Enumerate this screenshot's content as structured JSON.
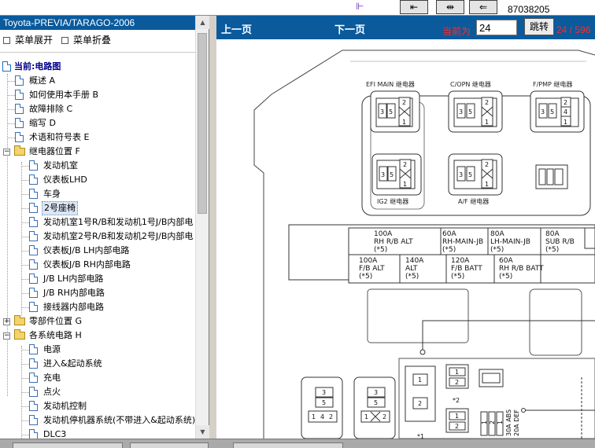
{
  "topbar": {
    "book_id": "87038205",
    "corner_mark": "⊩"
  },
  "tree": {
    "title": "Toyota-PREVIA/TARAGO-2006",
    "expand_label": "菜单展开",
    "collapse_label": "菜单折叠",
    "root_label": "当前:电路图",
    "items": [
      {
        "label": "概述 A"
      },
      {
        "label": "如何使用本手册 B"
      },
      {
        "label": "故障排除 C"
      },
      {
        "label": "缩写 D"
      },
      {
        "label": "术语和符号表 E"
      },
      {
        "label": "继电器位置 F"
      },
      {
        "label": "发动机室"
      },
      {
        "label": "仪表板LHD"
      },
      {
        "label": "车身"
      },
      {
        "label": "2号座椅"
      },
      {
        "label": "发动机室1号R/B和发动机1号J/B内部电"
      },
      {
        "label": "发动机室2号R/B和发动机2号J/B内部电"
      },
      {
        "label": "仪表板J/B LH内部电路"
      },
      {
        "label": "仪表板J/B RH内部电路"
      },
      {
        "label": "J/B LH内部电路"
      },
      {
        "label": "J/B RH内部电路"
      },
      {
        "label": "接线器内部电路"
      },
      {
        "label": "零部件位置 G"
      },
      {
        "label": "各系统电路 H"
      },
      {
        "label": "电源"
      },
      {
        "label": "进入&起动系统"
      },
      {
        "label": "充电"
      },
      {
        "label": "点火"
      },
      {
        "label": "发动机控制"
      },
      {
        "label": "发动机停机器系统(不带进入&起动系统)"
      },
      {
        "label": "DLC3"
      }
    ]
  },
  "nav": {
    "prev_label": "上一页",
    "next_label": "下一页",
    "current_label": "当前为",
    "page_value": "24",
    "jump_label": "跳转",
    "page_count": "24 / 596"
  },
  "diagram": {
    "relays": {
      "efi_main": "EFI MAIN 继电器",
      "c_opn": "C/OPN 继电器",
      "f_pmp": "F/PMP 继电器",
      "ig2": "IG2 继电器",
      "af": "A/F 继电器"
    },
    "fuses_top": [
      {
        "amp": "100A",
        "name": "RH R/B ALT",
        "note": "(*5)"
      },
      {
        "amp": "60A",
        "name": "RH-MAIN-JB",
        "note": "(*5)"
      },
      {
        "amp": "80A",
        "name": "LH-MAIN-JB",
        "note": "(*5)"
      },
      {
        "amp": "80A",
        "name": "SUB R/B",
        "note": "(*5)"
      }
    ],
    "fuses_bottom": [
      {
        "amp": "100A",
        "name": "F/B ALT",
        "note": "(*5)"
      },
      {
        "amp": "140A",
        "name": "ALT",
        "note": "(*5)"
      },
      {
        "amp": "120A",
        "name": "F/B BATT",
        "note": "(*5)"
      },
      {
        "amp": "60A",
        "name": "RH R/B BATT",
        "note": "(*5)"
      }
    ],
    "small_fuses": [
      "30A ABS",
      "20A DEF"
    ],
    "callouts": [
      "*2",
      "*1"
    ]
  }
}
